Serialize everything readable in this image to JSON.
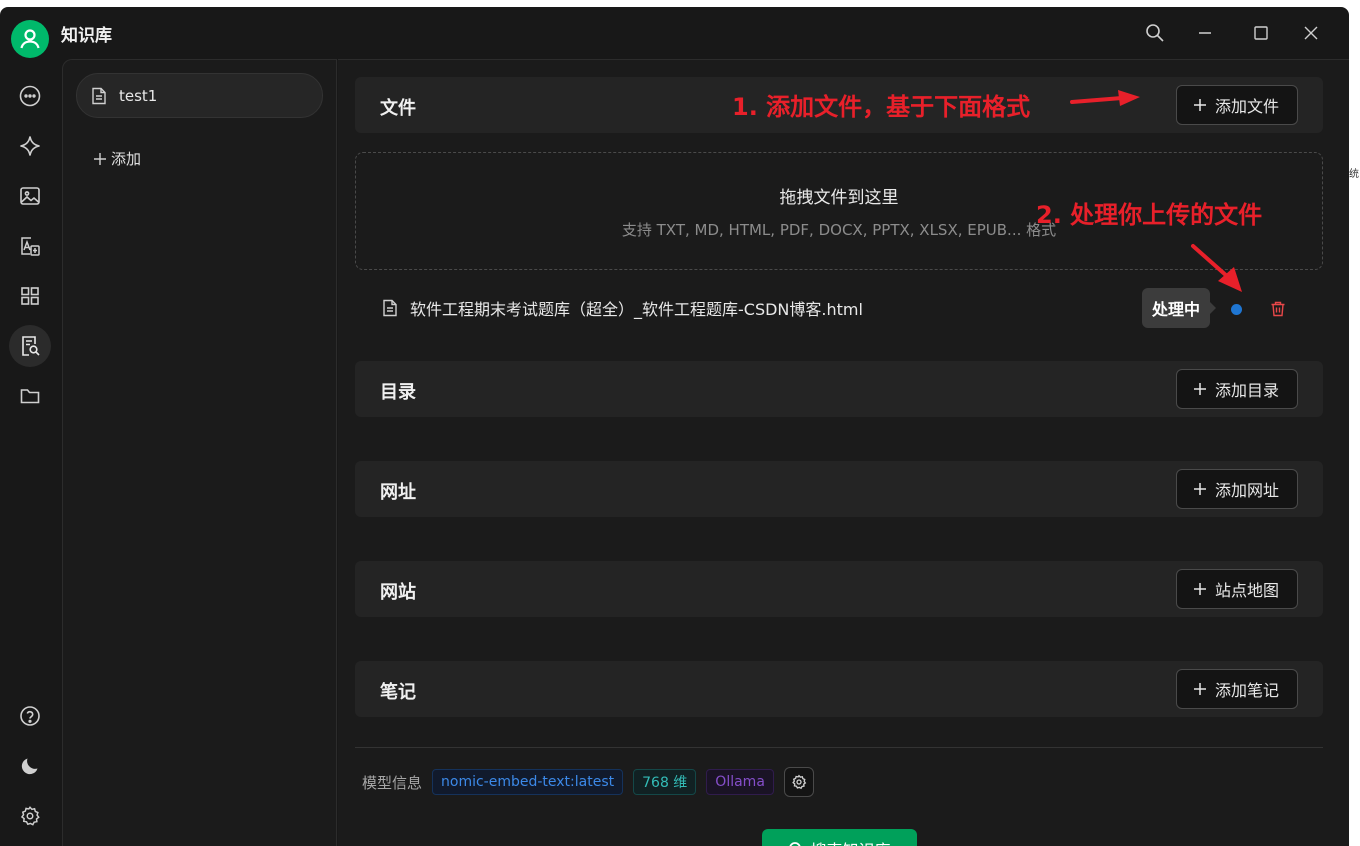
{
  "app": {
    "title": "知识库"
  },
  "kb_list": {
    "items": [
      {
        "label": "test1"
      }
    ],
    "add_label": "添加"
  },
  "sections": {
    "files": {
      "title": "文件",
      "button": "添加文件"
    },
    "dirs": {
      "title": "目录",
      "button": "添加目录"
    },
    "urls": {
      "title": "网址",
      "button": "添加网址"
    },
    "sites": {
      "title": "网站",
      "button": "站点地图"
    },
    "notes": {
      "title": "笔记",
      "button": "添加笔记"
    }
  },
  "dropzone": {
    "title": "拖拽文件到这里",
    "subtitle": "支持 TXT, MD, HTML, PDF, DOCX, PPTX, XLSX, EPUB... 格式"
  },
  "file": {
    "name": "软件工程期末考试题库（超全）_软件工程题库-CSDN博客.html",
    "tooltip": "处理中",
    "status_color": "#1f76d2"
  },
  "model": {
    "label": "模型信息",
    "model_name": "nomic-embed-text:latest",
    "dims": "768 维",
    "provider": "Ollama"
  },
  "search": {
    "label": "搜索知识库"
  },
  "annotations": {
    "step1": "1. 添加文件，基于下面格式",
    "step2": "2. 处理你上传的文件"
  },
  "edge": {
    "text": "统"
  },
  "colors": {
    "accent": "#00b96b",
    "annotation": "#e8202a",
    "danger": "#e84749"
  }
}
